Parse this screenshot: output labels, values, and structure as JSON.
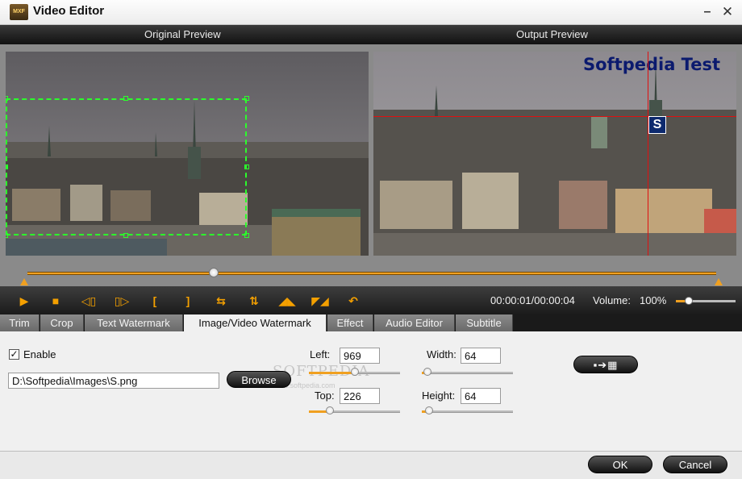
{
  "window": {
    "title": "Video Editor",
    "icon_label": "MXF",
    "minimize": "–",
    "close": "✕"
  },
  "preview": {
    "original_label": "Original Preview",
    "output_label": "Output Preview",
    "watermark_text": "Softpedia Test",
    "watermark_image_letter": "S"
  },
  "player": {
    "time": "00:00:01/00:00:04",
    "volume_label": "Volume:",
    "volume_value": "100%",
    "volume_level": 0.22,
    "timeline_position": 0.27
  },
  "tabs": [
    {
      "label": "Trim"
    },
    {
      "label": "Crop"
    },
    {
      "label": "Text Watermark"
    },
    {
      "label": "Image/Video Watermark",
      "active": true
    },
    {
      "label": "Effect"
    },
    {
      "label": "Audio Editor"
    },
    {
      "label": "Subtitle"
    }
  ],
  "watermark": {
    "enable_label": "Enable",
    "enabled": true,
    "path": "D:\\Softpedia\\Images\\S.png",
    "browse_label": "Browse",
    "left_label": "Left:",
    "left_value": "969",
    "top_label": "Top:",
    "top_value": "226",
    "width_label": "Width:",
    "width_value": "64",
    "height_label": "Height:",
    "height_value": "64",
    "bg_watermark": "SOFTPEDIA",
    "bg_watermark_sub": "www.softpedia.com"
  },
  "footer": {
    "ok_label": "OK",
    "cancel_label": "Cancel"
  },
  "colors": {
    "accent": "#f0a020",
    "crop_guide": "#2bff2b",
    "guide_line": "#e01010"
  }
}
